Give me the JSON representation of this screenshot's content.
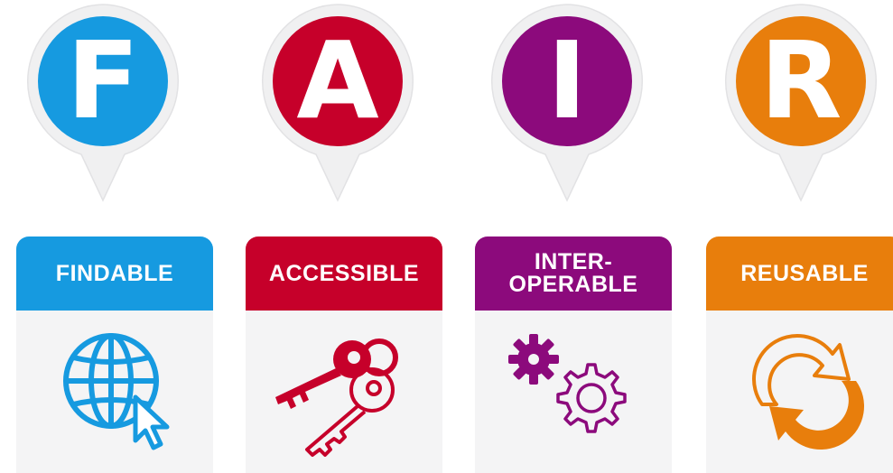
{
  "colors": {
    "findable": "#169ae0",
    "accessible": "#c6002a",
    "interoperable": "#8c0a7c",
    "reusable": "#e87e0c"
  },
  "letters": {
    "f": "F",
    "a": "A",
    "i": "I",
    "r": "R"
  },
  "cards": {
    "findable": {
      "title": "FINDABLE",
      "icon": "globe-cursor-icon"
    },
    "accessible": {
      "title": "ACCESSIBLE",
      "icon": "keys-icon"
    },
    "interoperable": {
      "title_lines": [
        "INTER-",
        "OPERABLE"
      ],
      "icon": "gears-icon"
    },
    "reusable": {
      "title": "REUSABLE",
      "icon": "cycle-arrows-icon"
    }
  }
}
